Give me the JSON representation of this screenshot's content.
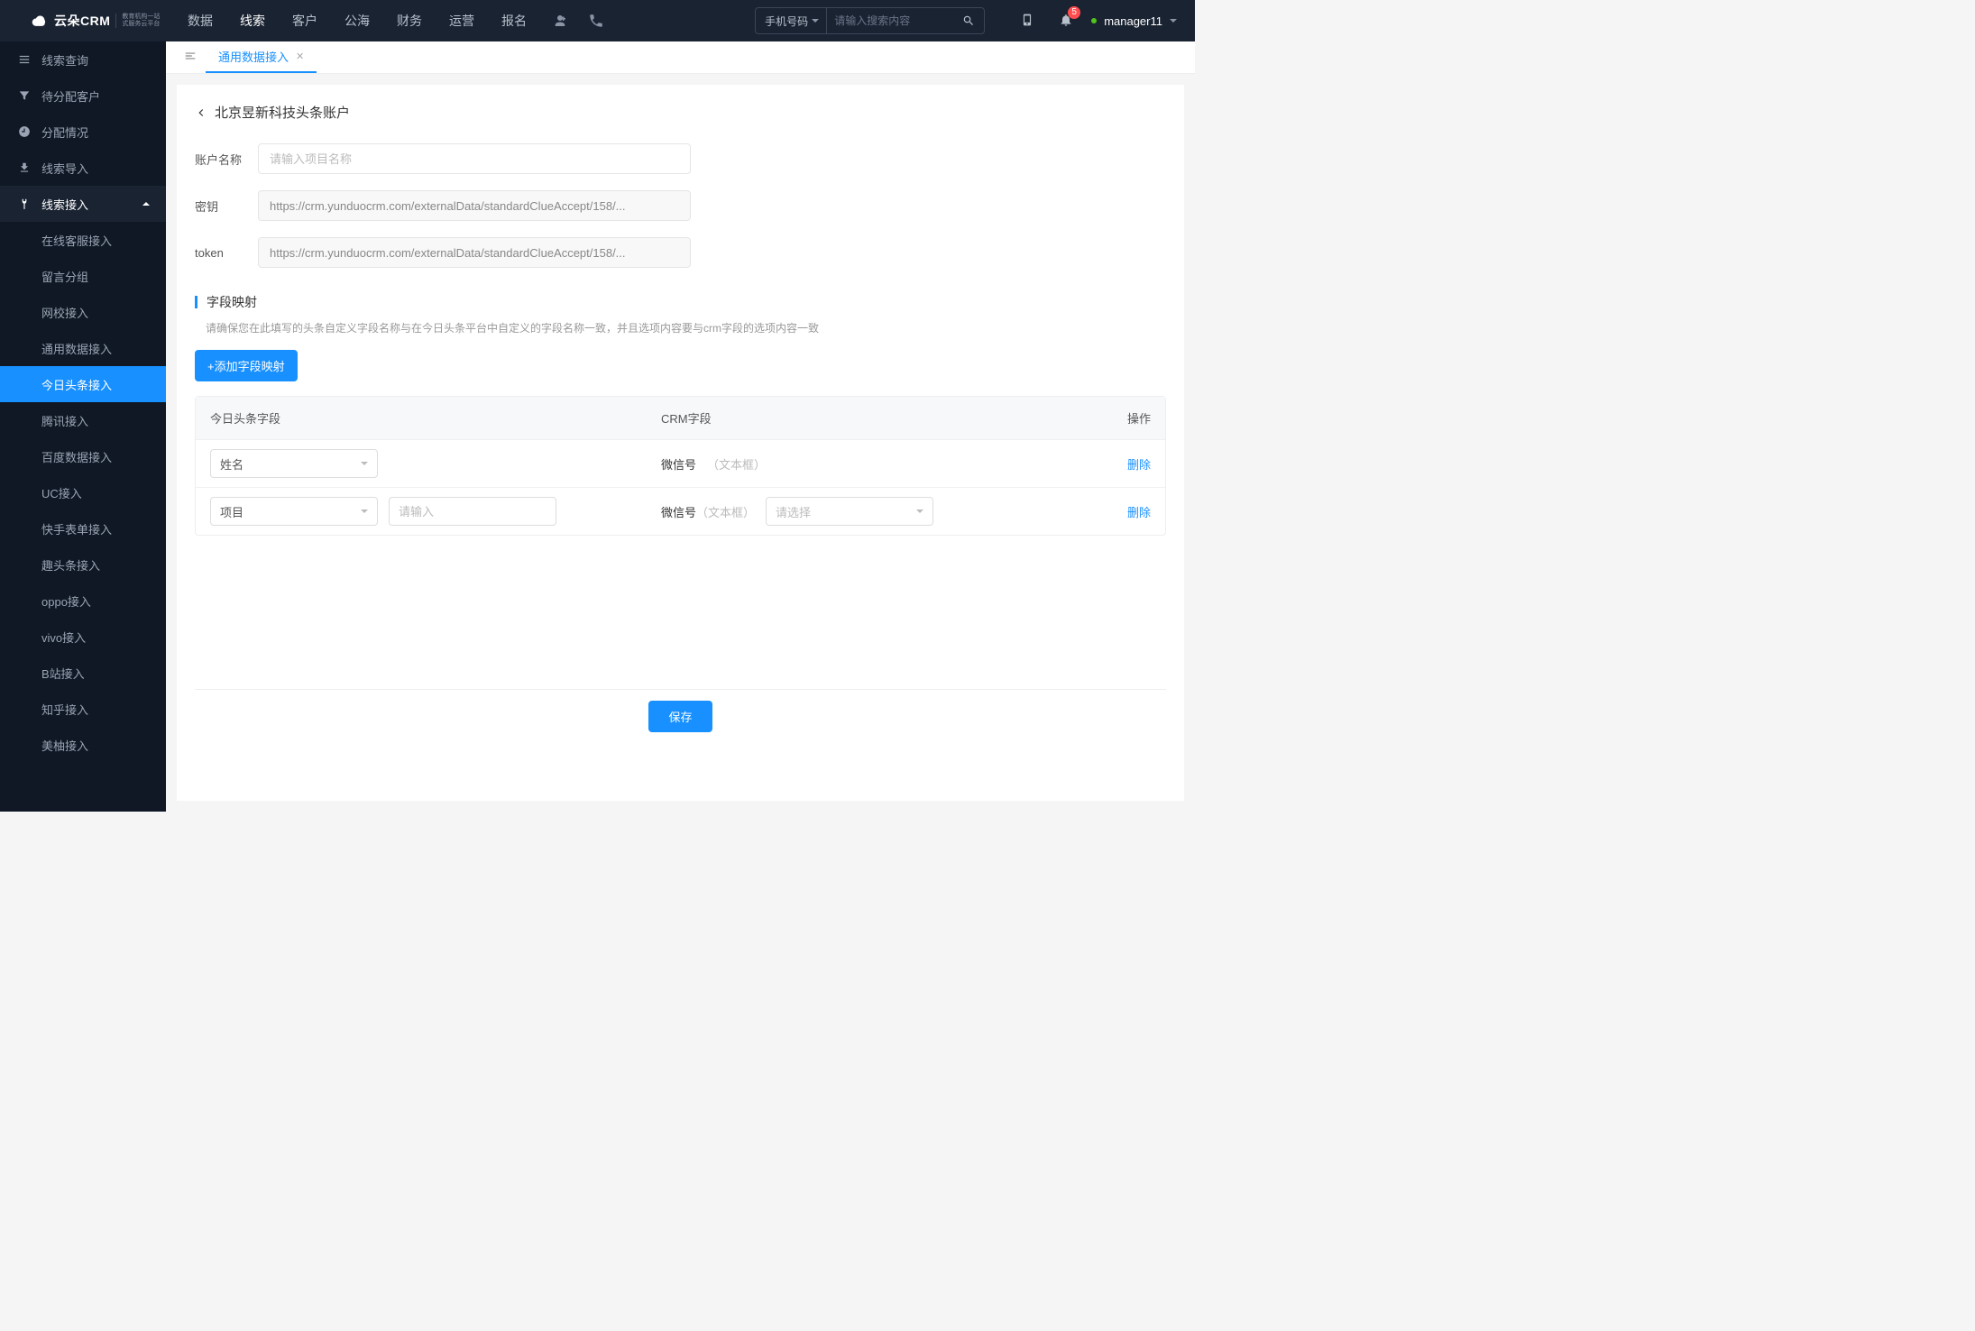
{
  "logo": {
    "brand": "云朵CRM",
    "sub_line1": "教育机构一站",
    "sub_line2": "式服务云平台"
  },
  "topnav": {
    "items": [
      "数据",
      "线索",
      "客户",
      "公海",
      "财务",
      "运营",
      "报名"
    ],
    "active_index": 1
  },
  "search": {
    "type_label": "手机号码",
    "placeholder": "请输入搜索内容"
  },
  "notification_count": "5",
  "user": {
    "name": "manager11"
  },
  "sidebar": {
    "items": [
      {
        "label": "线索查询",
        "icon": "search"
      },
      {
        "label": "待分配客户",
        "icon": "filter"
      },
      {
        "label": "分配情况",
        "icon": "clock"
      },
      {
        "label": "线索导入",
        "icon": "import"
      }
    ],
    "group": {
      "label": "线索接入",
      "icon": "plug",
      "children": [
        "在线客服接入",
        "留言分组",
        "网校接入",
        "通用数据接入",
        "今日头条接入",
        "腾讯接入",
        "百度数据接入",
        "UC接入",
        "快手表单接入",
        "趣头条接入",
        "oppo接入",
        "vivo接入",
        "B站接入",
        "知乎接入",
        "美柚接入"
      ]
    },
    "active_sub": "今日头条接入"
  },
  "tabs": {
    "items": [
      {
        "label": "通用数据接入",
        "closable": true
      }
    ],
    "active_index": 0
  },
  "page": {
    "title": "北京昱新科技头条账户",
    "form": {
      "account_label": "账户名称",
      "account_placeholder": "请输入项目名称",
      "secret_label": "密钥",
      "secret_value": "https://crm.yunduocrm.com/externalData/standardClueAccept/158/...",
      "token_label": "token",
      "token_value": "https://crm.yunduocrm.com/externalData/standardClueAccept/158/..."
    },
    "mapping": {
      "title": "字段映射",
      "hint": "请确保您在此填写的头条自定义字段名称与在今日头条平台中自定义的字段名称一致，并且选项内容要与crm字段的选项内容一致",
      "add_button": "+添加字段映射",
      "columns": {
        "c1": "今日头条字段",
        "c2": "CRM字段",
        "c3": "操作"
      },
      "rows": [
        {
          "tt_select": "姓名",
          "tt_extra": null,
          "crm_label": "微信号",
          "crm_type": "（文本框）",
          "crm_select": null,
          "action": "删除"
        },
        {
          "tt_select": "项目",
          "tt_extra_placeholder": "请输入",
          "crm_label": "微信号",
          "crm_type": "（文本框）",
          "crm_select_placeholder": "请选择",
          "action": "删除"
        }
      ]
    },
    "save_button": "保存"
  }
}
